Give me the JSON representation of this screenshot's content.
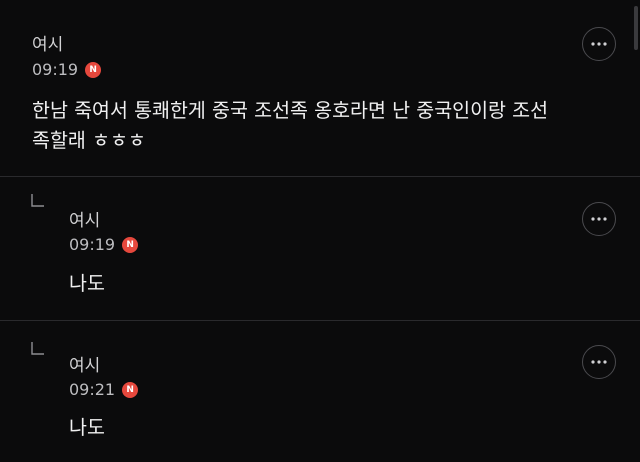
{
  "comments": [
    {
      "author": "여시",
      "time": "09:19",
      "badge": "N",
      "text_line1": "한남 죽여서 통쾌한게 중국 조선족 옹호라면 난 중국인이랑 조선",
      "text_line2": "족할래 ㅎㅎㅎ"
    }
  ],
  "replies": [
    {
      "author": "여시",
      "time": "09:19",
      "badge": "N",
      "text": "나도"
    },
    {
      "author": "여시",
      "time": "09:21",
      "badge": "N",
      "text": "나도"
    }
  ],
  "icons": {
    "more": "more-options-icon",
    "reply": "reply-arrow-icon"
  },
  "colors": {
    "background": "#0b0b0c",
    "badge": "#e6483d",
    "divider": "#2a2a2d"
  }
}
